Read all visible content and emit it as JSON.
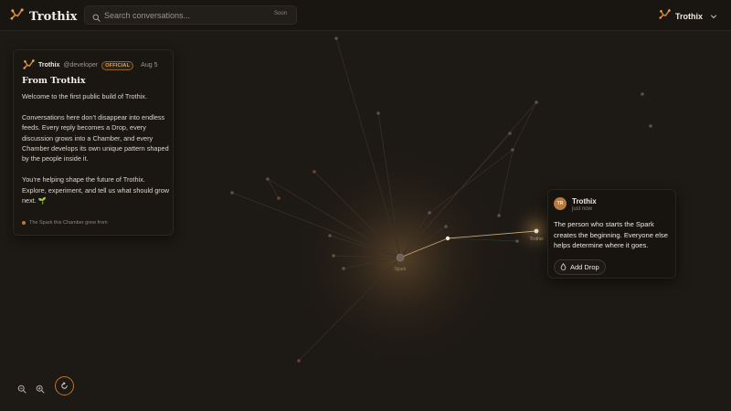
{
  "header": {
    "brand": "Trothix",
    "logo_icon": "trothix-logo-icon",
    "search": {
      "placeholder": "Search conversations...",
      "badge": "Soon",
      "icon": "search-icon"
    },
    "user": {
      "name": "Trothix",
      "icon": "trothix-logo-icon",
      "chevron": "chevron-down-icon"
    }
  },
  "post": {
    "author": "Trothix",
    "handle": "@developer",
    "tag": "OFFICIAL",
    "date": "Aug 5",
    "title": "From Trothix",
    "paragraphs": [
      "Welcome to the first public build of Trothix.",
      "Conversations here don’t disappear into endless feeds. Every reply becomes a Drop, every discussion grows into a Chamber, and every Chamber develops its own unique pattern shaped by the people inside it.",
      "You’re helping shape the future of Trothix. Explore, experiment, and tell us what should grow next. 🌱"
    ],
    "footer": "The Spark this Chamber grew from"
  },
  "graph": {
    "spark_label": "Spark",
    "node_label": "Trothix",
    "accent": "#c8742e"
  },
  "popup": {
    "avatar": "TR",
    "name": "Trothix",
    "time": "just now",
    "text": "The person who starts the Spark creates the beginning. Everyone else helps determine where it goes.",
    "button": "Add Drop",
    "button_icon": "drop-icon"
  },
  "controls": {
    "zoom_out_icon": "zoom-out-icon",
    "zoom_in_icon": "zoom-in-icon",
    "reset_icon": "reset-icon"
  },
  "colors": {
    "background": "#1d1914",
    "accent": "#c8742e",
    "tag": "#e0a44c"
  }
}
